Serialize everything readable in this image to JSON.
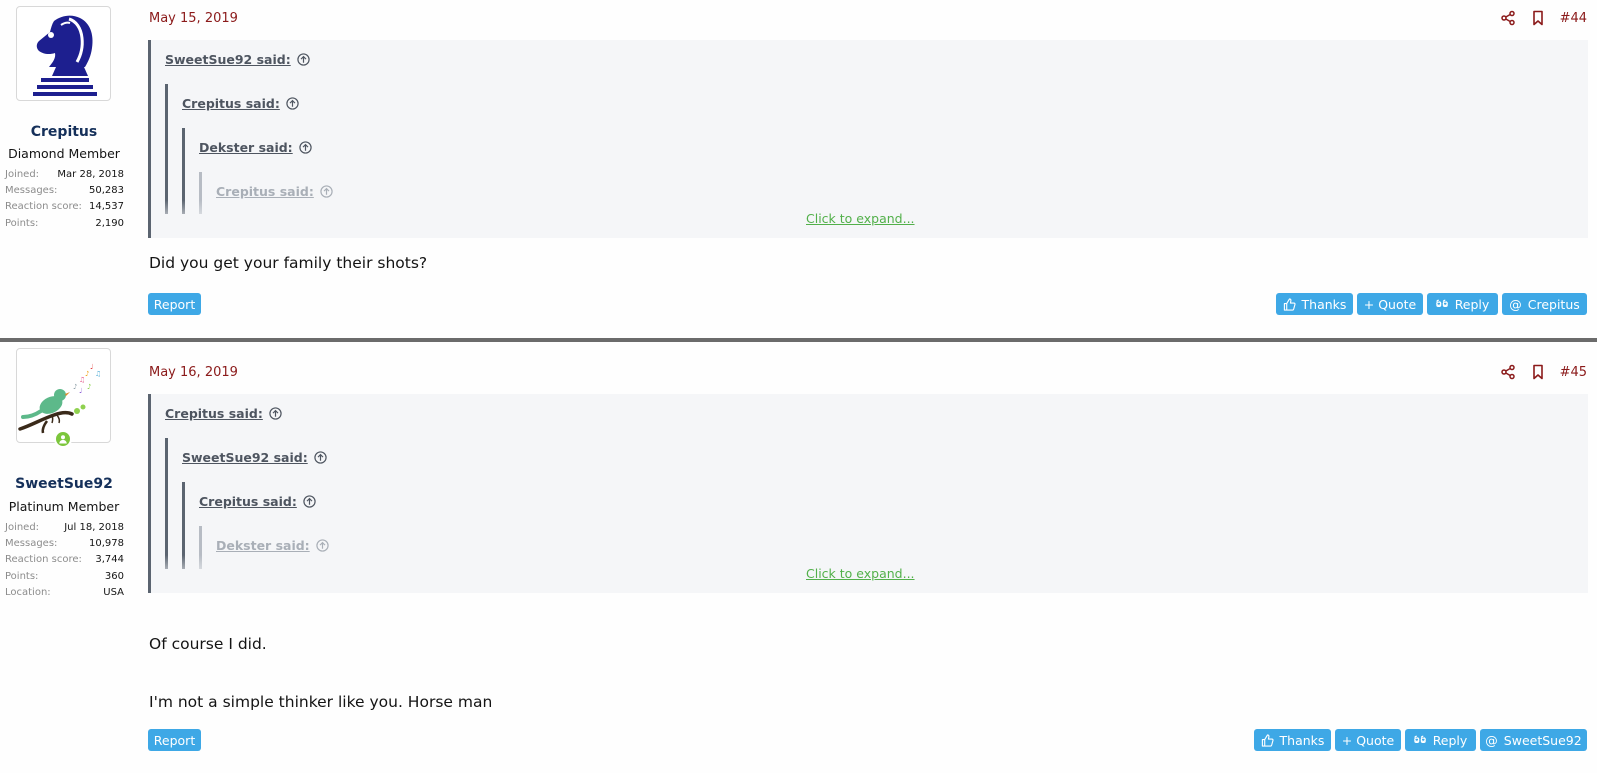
{
  "posts": [
    {
      "author": {
        "username": "Crepitus",
        "title": "Diamond Member",
        "avatar_icon": "chess-knight-icon",
        "stats": [
          {
            "label": "Joined:",
            "value": "Mar 28, 2018"
          },
          {
            "label": "Messages:",
            "value": "50,283"
          },
          {
            "label": "Reaction score:",
            "value": "14,537"
          },
          {
            "label": "Points:",
            "value": "2,190"
          }
        ]
      },
      "date": "May 15, 2019",
      "post_number": "#44",
      "quotes": [
        {
          "label": "SweetSue92 said:"
        },
        {
          "label": "Crepitus said:"
        },
        {
          "label": "Dekster said:"
        },
        {
          "label": "Crepitus said:"
        }
      ],
      "expand_label": "Click to expand...",
      "body": [
        "Did you get your family their shots?"
      ],
      "report_label": "Report",
      "actions": {
        "thanks": "Thanks",
        "quote": "+ Quote",
        "reply": "Reply",
        "mention": "Crepitus"
      }
    },
    {
      "author": {
        "username": "SweetSue92",
        "title": "Platinum Member",
        "avatar_icon": "singing-bird-icon",
        "stats": [
          {
            "label": "Joined:",
            "value": "Jul 18, 2018"
          },
          {
            "label": "Messages:",
            "value": "10,978"
          },
          {
            "label": "Reaction score:",
            "value": "3,744"
          },
          {
            "label": "Points:",
            "value": "360"
          },
          {
            "label": "Location:",
            "value": "USA"
          }
        ]
      },
      "date": "May 16, 2019",
      "post_number": "#45",
      "quotes": [
        {
          "label": "Crepitus said:"
        },
        {
          "label": "SweetSue92 said:"
        },
        {
          "label": "Crepitus said:"
        },
        {
          "label": "Dekster said:"
        }
      ],
      "expand_label": "Click to expand...",
      "body": [
        "Of course I did.",
        "I'm not a simple thinker like you. Horse man"
      ],
      "report_label": "Report",
      "actions": {
        "thanks": "Thanks",
        "quote": "+ Quote",
        "reply": "Reply",
        "mention": "SweetSue92"
      }
    }
  ],
  "colors": {
    "accent": "#3ea8e6",
    "date": "#8b1a1a",
    "username": "#15305a",
    "expand_link": "#52b04a",
    "quote_bg": "#f5f6f8"
  }
}
